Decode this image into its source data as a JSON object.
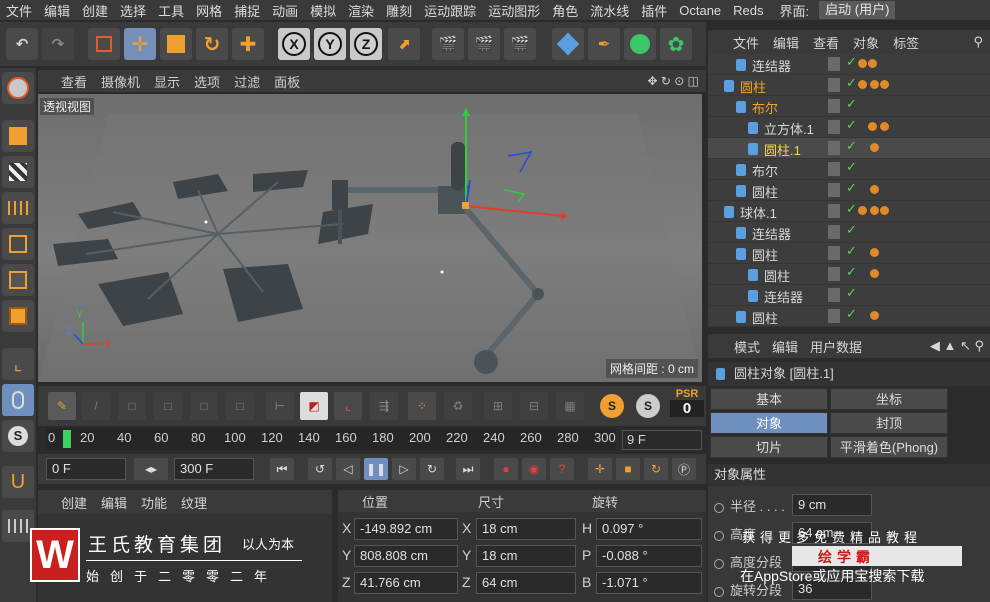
{
  "menubar": {
    "items": [
      "文件",
      "编辑",
      "创建",
      "选择",
      "工具",
      "网格",
      "捕捉",
      "动画",
      "模拟",
      "渲染",
      "雕刻",
      "运动跟踪",
      "运动图形",
      "角色",
      "流水线",
      "插件",
      "Octane",
      "Reds"
    ],
    "layout_label": "界面:",
    "layout_value": "启动 (用户)"
  },
  "viewport": {
    "menu": [
      "查看",
      "摄像机",
      "显示",
      "选项",
      "过滤",
      "面板"
    ],
    "label": "透视视图",
    "grid_spacing": "网格间距 : 0 cm"
  },
  "timeline": {
    "ticks": [
      "0",
      "20",
      "40",
      "60",
      "80",
      "100",
      "120",
      "140",
      "160",
      "180",
      "200",
      "220",
      "240",
      "260",
      "280",
      "300"
    ],
    "current_frame": "9 F",
    "psr_label": "PSR",
    "psr_value": "0",
    "start_field": "0 F",
    "end_field": "300 F"
  },
  "material": {
    "menu": [
      "创建",
      "编辑",
      "功能",
      "纹理"
    ]
  },
  "coordinates": {
    "headers": [
      "位置",
      "尺寸",
      "旋转"
    ],
    "rows": [
      {
        "axis": "X",
        "pos": "-149.892 cm",
        "size_axis": "X",
        "size": "18 cm",
        "rot_axis": "H",
        "rot": "0.097 °"
      },
      {
        "axis": "Y",
        "pos": "808.808 cm",
        "size_axis": "Y",
        "size": "18 cm",
        "rot_axis": "P",
        "rot": "-0.088 °"
      },
      {
        "axis": "Z",
        "pos": "41.766 cm",
        "size_axis": "Z",
        "size": "64 cm",
        "rot_axis": "B",
        "rot": "-1.071 °"
      }
    ]
  },
  "object_manager": {
    "menu": [
      "文件",
      "编辑",
      "查看",
      "对象",
      "标签"
    ],
    "rows": [
      {
        "name": "连结器",
        "indent": 1,
        "style": "normal"
      },
      {
        "name": "圆柱",
        "indent": 0,
        "style": "highlight"
      },
      {
        "name": "布尔",
        "indent": 1,
        "style": "highlight"
      },
      {
        "name": "立方体.1",
        "indent": 2,
        "style": "normal"
      },
      {
        "name": "圆柱.1",
        "indent": 2,
        "style": "selected"
      },
      {
        "name": "布尔",
        "indent": 1,
        "style": "normal"
      },
      {
        "name": "圆柱",
        "indent": 1,
        "style": "normal"
      },
      {
        "name": "球体.1",
        "indent": 0,
        "style": "normal"
      },
      {
        "name": "连结器",
        "indent": 1,
        "style": "normal"
      },
      {
        "name": "圆柱",
        "indent": 1,
        "style": "normal"
      },
      {
        "name": "圆柱",
        "indent": 2,
        "style": "normal"
      },
      {
        "name": "连结器",
        "indent": 2,
        "style": "normal"
      },
      {
        "name": "圆柱",
        "indent": 1,
        "style": "normal"
      }
    ]
  },
  "attributes": {
    "menu": [
      "模式",
      "编辑",
      "用户数据"
    ],
    "title": "圆柱对象 [圆柱.1]",
    "tabs": [
      {
        "label": "基本",
        "active": false
      },
      {
        "label": "坐标",
        "active": false
      },
      {
        "label": "对象",
        "active": true
      },
      {
        "label": "封顶",
        "active": false
      },
      {
        "label": "切片",
        "active": false
      },
      {
        "label": "平滑着色(Phong)",
        "active": false
      }
    ],
    "section": "对象属性",
    "props": [
      {
        "label": "半径 . . . .",
        "value": "9 cm"
      },
      {
        "label": "高度",
        "value": "64 cm"
      },
      {
        "label": "高度分段",
        "value": "1"
      },
      {
        "label": "旋转分段",
        "value": "36"
      }
    ]
  },
  "watermark": {
    "logo_letter": "W",
    "title": "王氏教育集团",
    "slogan": "以人为本",
    "subtitle": "始创于二零零二年",
    "right_line1": "获得更多免费精品教程",
    "right_brand": "绘学霸",
    "right_line3": "在AppStore或应用宝搜索下载"
  },
  "colors": {
    "panel": "#3a3a3a",
    "selected_tab": "#6f8fbf",
    "highlight_text": "#f0a030",
    "check_green": "#5ed05e"
  }
}
